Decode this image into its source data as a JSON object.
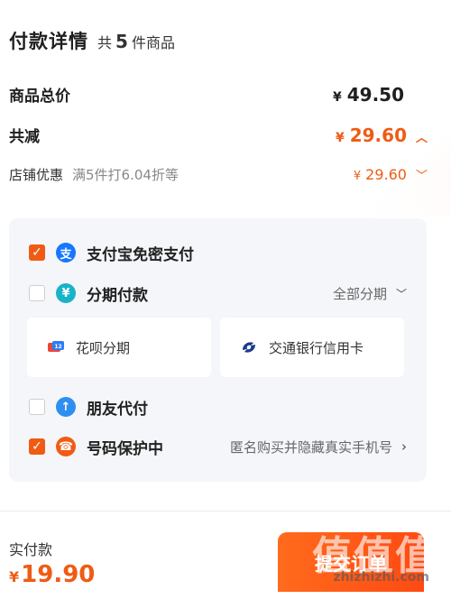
{
  "header": {
    "title": "付款详情",
    "count_prefix": "共",
    "count": "5",
    "count_suffix": "件商品"
  },
  "summary": {
    "total_label": "商品总价",
    "total_currency": "¥",
    "total_value": "49.50",
    "discount_label": "共减",
    "discount_currency": "¥",
    "discount_value": "29.60"
  },
  "shop_discount": {
    "label": "店铺优惠",
    "promo": "满5件打6.04折等",
    "currency": "¥",
    "value": "29.60"
  },
  "payment_options": {
    "alipay": {
      "label": "支付宝免密支付",
      "checked": true,
      "icon": "alipay-icon"
    },
    "installment": {
      "label": "分期付款",
      "checked": false,
      "icon": "installment-icon",
      "right_label": "全部分期"
    },
    "cards": [
      {
        "label": "花呗分期",
        "icon": "huabei-icon"
      },
      {
        "label": "交通银行信用卡",
        "icon": "bocom-icon"
      }
    ],
    "friend_pay": {
      "label": "朋友代付",
      "checked": false,
      "icon": "friend-pay-icon"
    },
    "number_protect": {
      "label": "号码保护中",
      "checked": true,
      "icon": "shield-icon",
      "right_label": "匿名购买并隐藏真实手机号"
    }
  },
  "footer": {
    "paid_label": "实付款",
    "currency": "¥",
    "paid_value": "19.90",
    "submit_label": "提交订单"
  },
  "watermark": {
    "big": "值值值",
    "small": "zhizhizhi.com"
  },
  "colors": {
    "accent": "#f05b14",
    "alipay": "#1677ff"
  }
}
